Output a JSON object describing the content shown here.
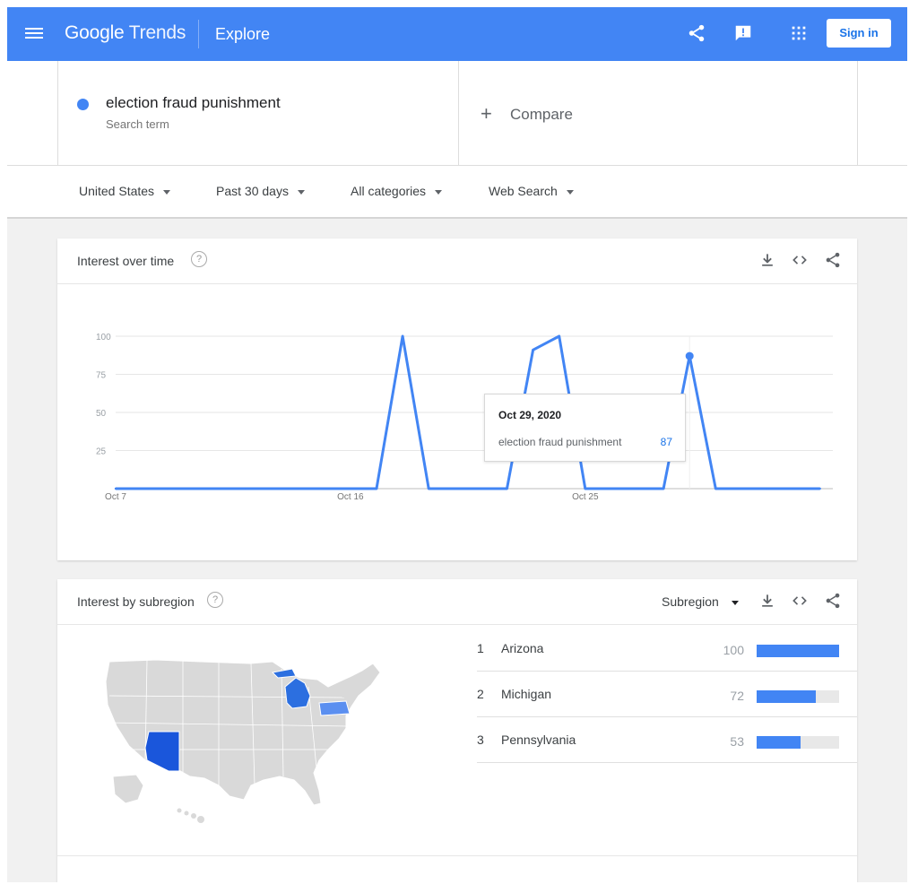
{
  "header": {
    "brand_google": "Google",
    "brand_trends": "Trends",
    "section": "Explore",
    "sign_in": "Sign in",
    "color": "#4285f4",
    "icons": [
      "menu-icon",
      "share-icon",
      "feedback-icon",
      "apps-icon"
    ]
  },
  "search": {
    "term": "election fraud punishment",
    "term_sub": "Search term",
    "term_color": "#4285f4",
    "compare_plus": "+",
    "compare_label": "Compare"
  },
  "filters": {
    "region": "United States",
    "period": "Past 30 days",
    "category": "All categories",
    "property": "Web Search"
  },
  "interest_over_time": {
    "title": "Interest over time",
    "help": "?",
    "tooltip": {
      "date": "Oct 29, 2020",
      "term": "election fraud punishment",
      "value": "87"
    }
  },
  "chart_data": {
    "type": "line",
    "series": [
      {
        "name": "election fraud punishment",
        "color": "#4285f4",
        "x": [
          "Oct 7",
          "Oct 8",
          "Oct 9",
          "Oct 10",
          "Oct 11",
          "Oct 12",
          "Oct 13",
          "Oct 14",
          "Oct 15",
          "Oct 16",
          "Oct 17",
          "Oct 18",
          "Oct 19",
          "Oct 20",
          "Oct 21",
          "Oct 22",
          "Oct 23",
          "Oct 24",
          "Oct 25",
          "Oct 26",
          "Oct 27",
          "Oct 28",
          "Oct 29",
          "Oct 30",
          "Oct 31",
          "Nov 1",
          "Nov 2",
          "Nov 3"
        ],
        "values": [
          0,
          0,
          0,
          0,
          0,
          0,
          0,
          0,
          0,
          0,
          0,
          100,
          0,
          0,
          0,
          0,
          91,
          100,
          0,
          0,
          0,
          0,
          87,
          0,
          0,
          0,
          0,
          0
        ]
      }
    ],
    "x_tick_labels": [
      "Oct 7",
      "Oct 16",
      "Oct 25"
    ],
    "y_ticks": [
      25,
      50,
      75,
      100
    ],
    "ylim": [
      0,
      100
    ],
    "grid": true,
    "highlight": {
      "x": "Oct 29",
      "value": 87
    }
  },
  "interest_by_subregion": {
    "title": "Interest by subregion",
    "help": "?",
    "resolution": "Subregion",
    "rows": [
      {
        "rank": "1",
        "name": "Arizona",
        "value": 100
      },
      {
        "rank": "2",
        "name": "Michigan",
        "value": 72
      },
      {
        "rank": "3",
        "name": "Pennsylvania",
        "value": 53
      }
    ],
    "map_highlight_colors": {
      "Arizona": "#1a56db",
      "Michigan": "#2c6fe0",
      "Pennsylvania": "#5b8ff0"
    },
    "map_base_color": "#d9d9d9"
  }
}
